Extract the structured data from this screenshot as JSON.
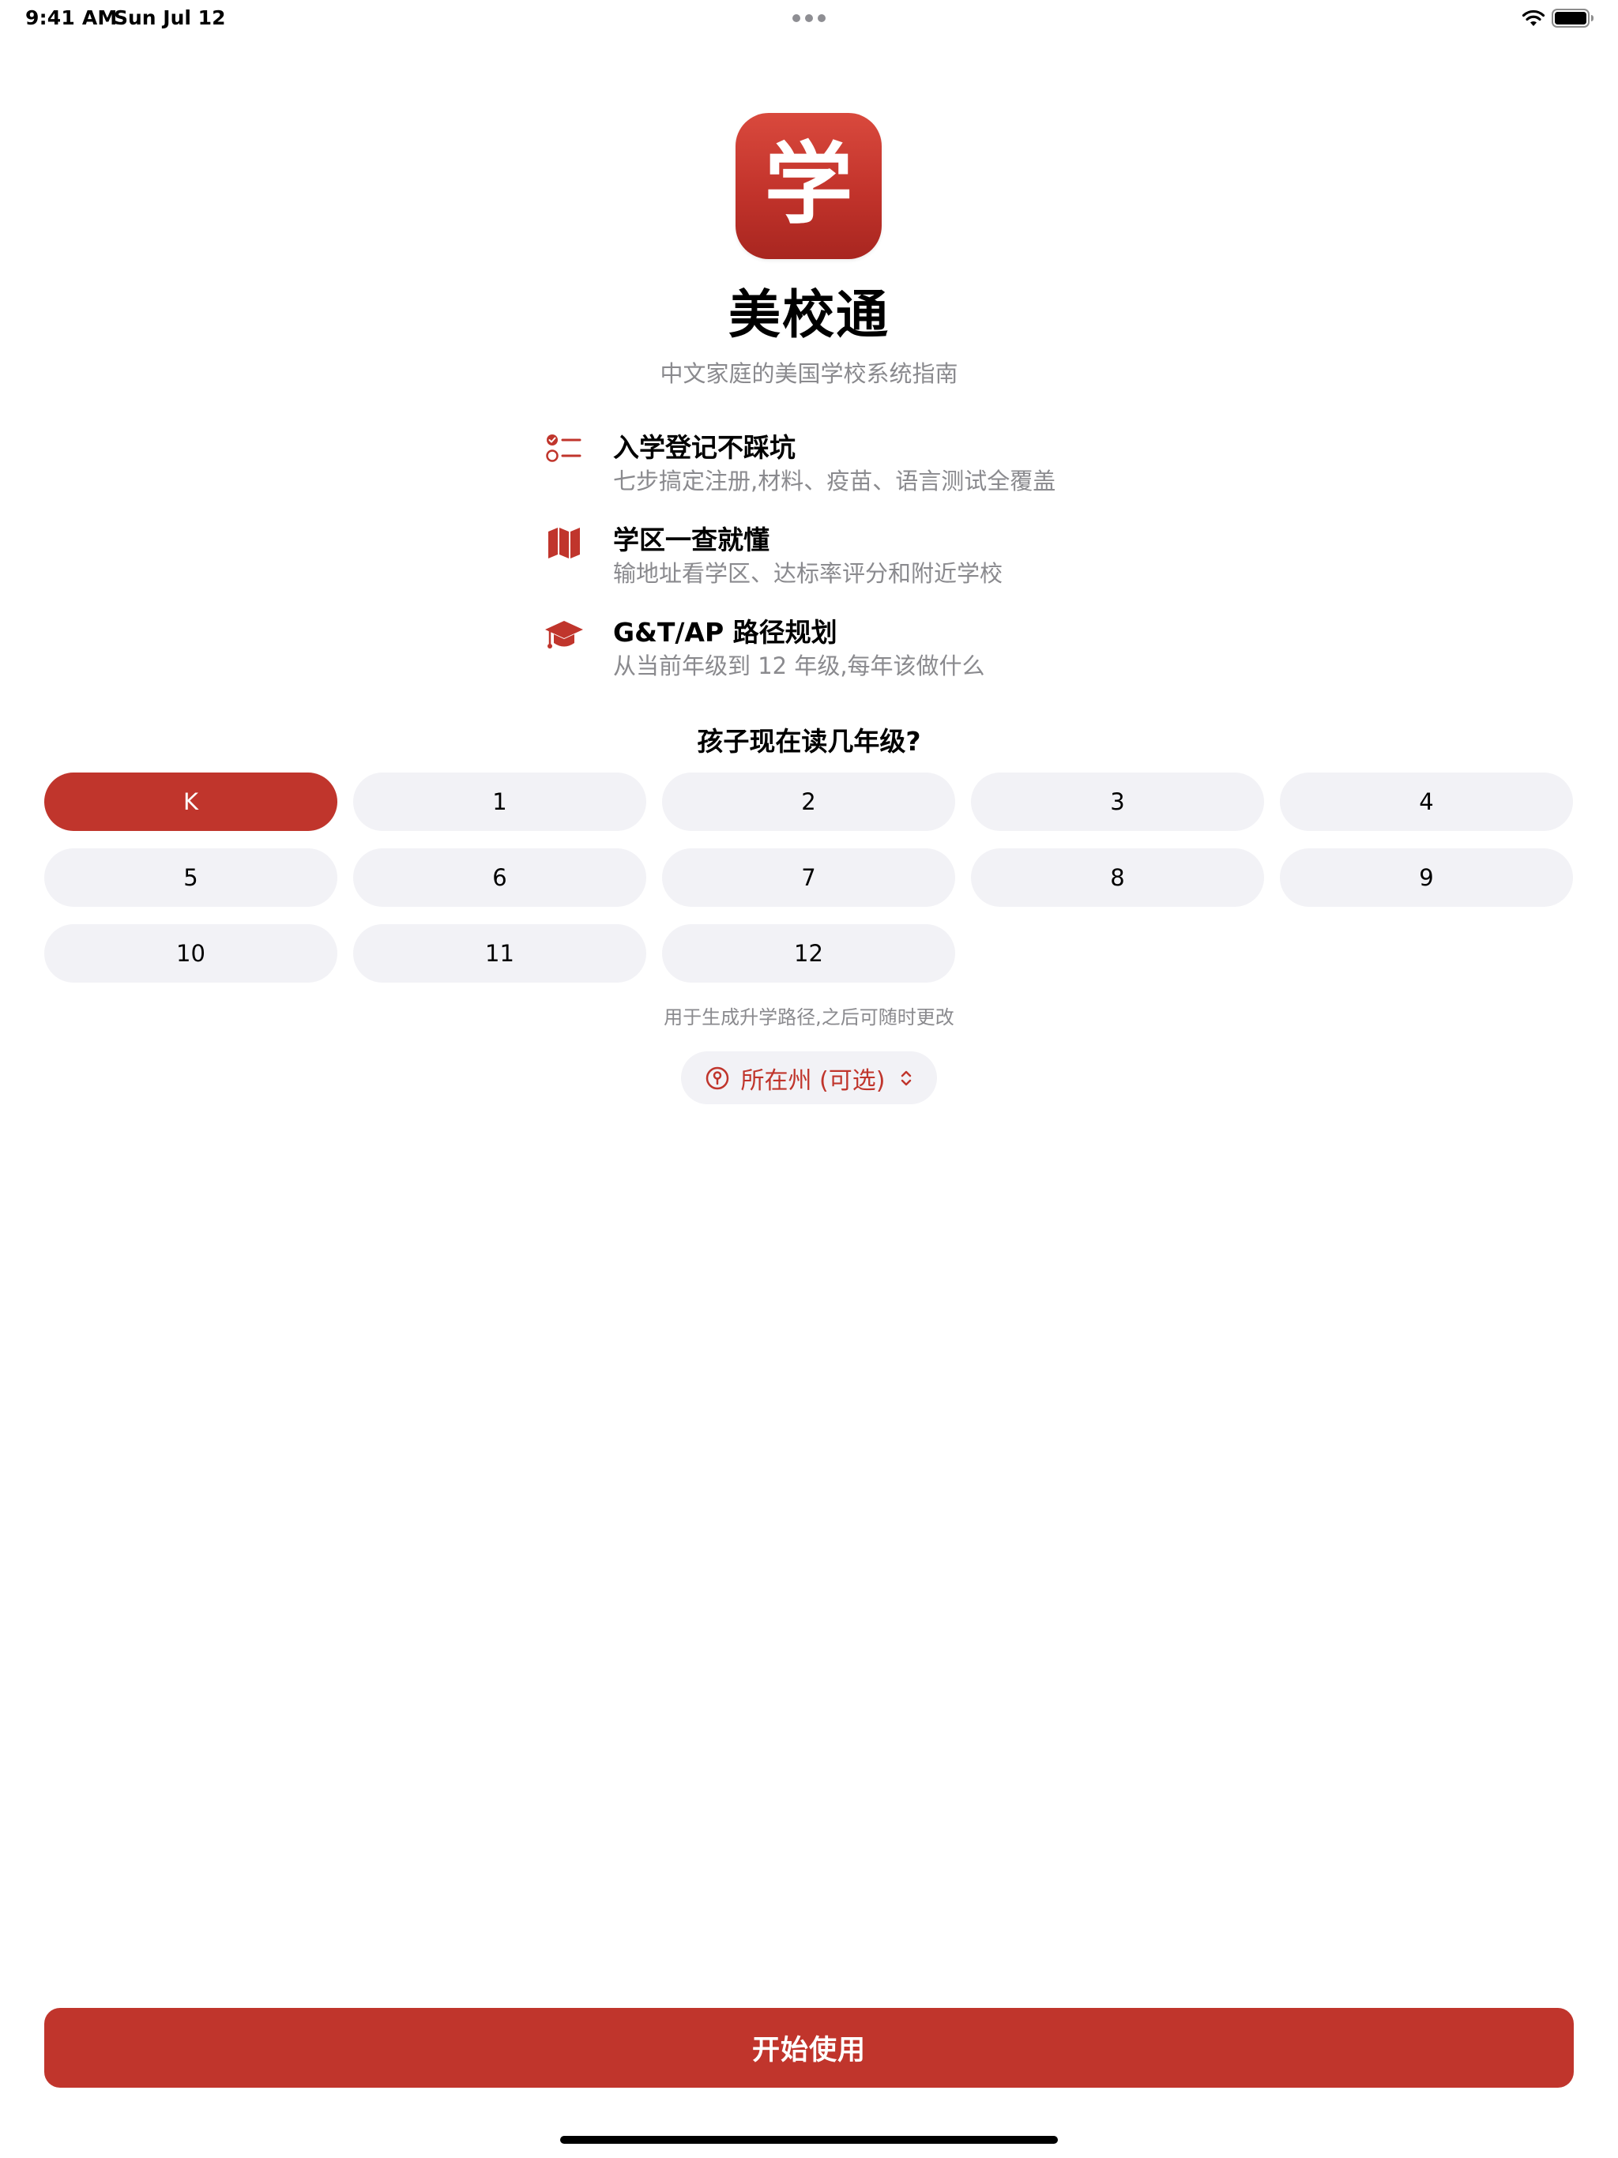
{
  "status_bar": {
    "time": "9:41 AM",
    "date": "Sun Jul 12"
  },
  "app": {
    "icon_glyph": "学",
    "title": "美校通",
    "subtitle": "中文家庭的美国学校系统指南"
  },
  "features": [
    {
      "icon": "checklist-icon",
      "title": "入学登记不踩坑",
      "desc": "七步搞定注册,材料、疫苗、语言测试全覆盖"
    },
    {
      "icon": "map-icon",
      "title": "学区一查就懂",
      "desc": "输地址看学区、达标率评分和附近学校"
    },
    {
      "icon": "graduation-cap-icon",
      "title": "G&T/AP 路径规划",
      "desc": "从当前年级到 12 年级,每年该做什么"
    }
  ],
  "grade": {
    "question": "孩子现在读几年级?",
    "options": [
      "K",
      "1",
      "2",
      "3",
      "4",
      "5",
      "6",
      "7",
      "8",
      "9",
      "10",
      "11",
      "12"
    ],
    "selected": "K",
    "hint": "用于生成升学路径,之后可随时更改"
  },
  "state_picker": {
    "label": "所在州 (可选)"
  },
  "start_button": {
    "label": "开始使用"
  },
  "colors": {
    "accent": "#c0352c",
    "chip_bg": "#f2f2f6",
    "secondary_text": "#8a8a8e"
  }
}
